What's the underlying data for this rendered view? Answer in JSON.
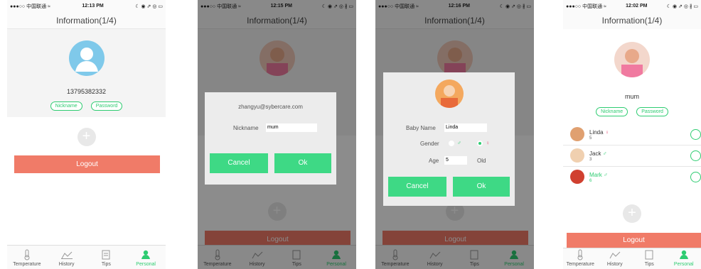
{
  "status": {
    "s1": {
      "carrier": "●●●○○ 中国联通 ≈",
      "time": "12:13 PM",
      "icons": "☾ ◉ ⇗ ◎ ▭"
    },
    "s2": {
      "carrier": "●●●○○ 中国联通 ≈",
      "time": "12:15 PM",
      "icons": "☾ ◉ ⇗ ◎ ∦ ▭"
    },
    "s3": {
      "carrier": "●●●○○ 中国联通 ≈",
      "time": "12:16 PM",
      "icons": "☾ ◉ ⇗ ◎ ∦ ▭"
    },
    "s4": {
      "carrier": "●●●○○ 中国联通 ≈",
      "time": "12:02 PM",
      "icons": "☾ ◉ ⇗ ◎ ∦ ▭"
    }
  },
  "header": {
    "title": "Information(1/4)"
  },
  "profile": {
    "phone": "13795382332",
    "nickname_label": "Nickname",
    "password_label": "Password",
    "name": "mum"
  },
  "logout_label": "Logout",
  "tabs": [
    {
      "label": "Temperature",
      "icon": "thermometer-icon"
    },
    {
      "label": "History",
      "icon": "chart-icon"
    },
    {
      "label": "Tips",
      "icon": "notes-icon"
    },
    {
      "label": "Personal",
      "icon": "person-icon"
    }
  ],
  "nickname_dialog": {
    "email": "zhangyu@sybercare.com",
    "nickname_label": "Nickname",
    "nickname_value": "mum",
    "cancel_label": "Cancel",
    "ok_label": "Ok"
  },
  "baby_dialog": {
    "name_label": "Baby Name",
    "name_value": "Linda",
    "gender_label": "Gender",
    "male_symbol": "♂",
    "female_symbol": "♀",
    "age_label": "Age",
    "age_value": "5",
    "age_unit": "Old",
    "cancel_label": "Cancel",
    "ok_label": "Ok"
  },
  "babies": [
    {
      "name": "Linda",
      "symbol": "♀",
      "age": "5"
    },
    {
      "name": "Jack",
      "symbol": "♂",
      "age": "3"
    },
    {
      "name": "Mark",
      "symbol": "♂",
      "age": "6"
    }
  ],
  "colors": {
    "accent": "#2ecc71",
    "logout": "#f07b68",
    "female": "#e86a8a"
  }
}
